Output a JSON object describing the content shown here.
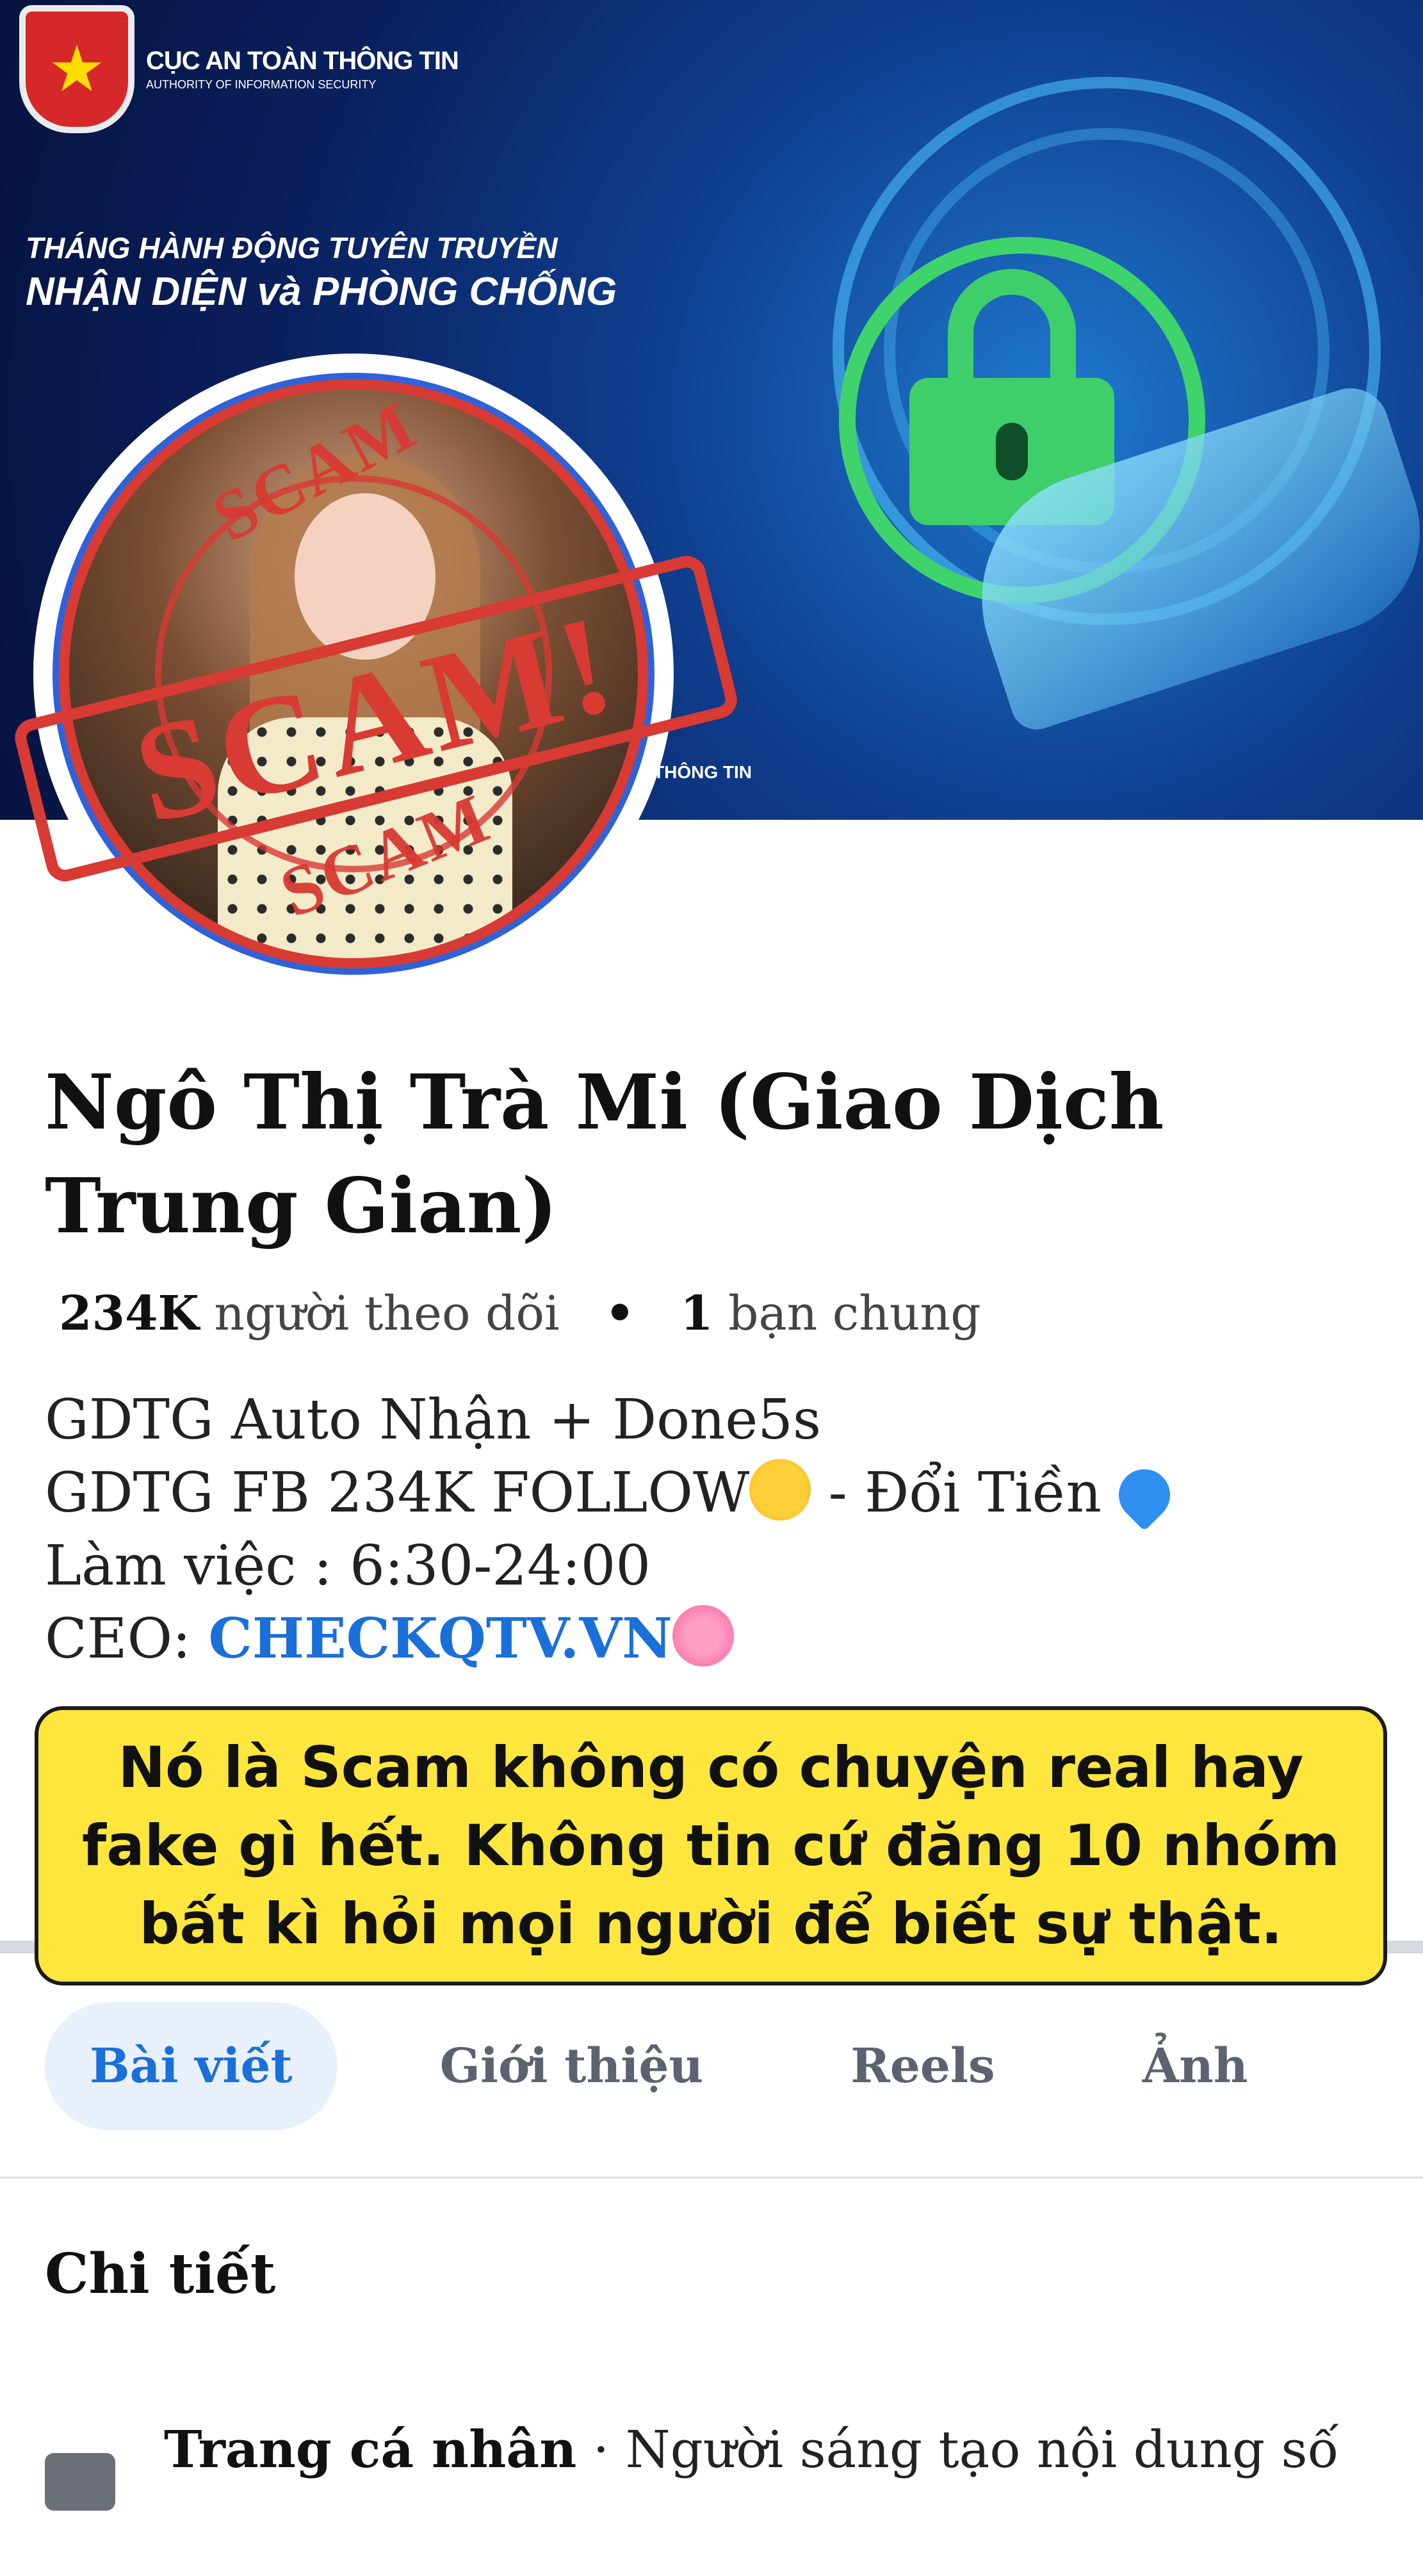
{
  "cover": {
    "org_name": "CỤC AN TOÀN THÔNG TIN",
    "org_subtitle": "AUTHORITY OF INFORMATION SECURITY",
    "headline_line1": "THÁNG HÀNH ĐỘNG TUYÊN TRUYỀN",
    "headline_line2": "NHẬN DIỆN và PHÒNG CHỐNG",
    "corner_text": "THÔNG TIN"
  },
  "avatar": {
    "stamp_main": "SCAM!",
    "stamp_top": "SCAM",
    "stamp_bottom": "SCAM"
  },
  "profile": {
    "name": "Ngô Thị Trà Mi (Giao Dịch Trung Gian)",
    "followers_count": "234K",
    "followers_label": "người theo dõi",
    "separator": "•",
    "mutual_count": "1",
    "mutual_label": "bạn chung"
  },
  "bio": {
    "line1": "GDTG Auto Nhận + Done5s",
    "line2_a": "GDTG FB 234K FOLLOW",
    "line2_b": " - Đổi Tiền ",
    "line3": "Làm việc : 6:30-24:00",
    "line4_prefix": "CEO: ",
    "line4_link": "CHECKQTV.VN"
  },
  "note": {
    "text": "Nó là Scam không có chuyện real hay fake gì hết. Không tin cứ đăng 10 nhóm bất kì hỏi mọi người để biết sự thật."
  },
  "tabs": [
    "Bài viết",
    "Giới thiệu",
    "Reels",
    "Ảnh"
  ],
  "details": {
    "title": "Chi tiết",
    "row_bold": "Trang cá nhân",
    "row_rest": " · Người sáng tạo nội dung số"
  },
  "colors": {
    "accent": "#1b6fd8",
    "stamp_red": "#d83a34",
    "note_yellow": "#ffe63c"
  }
}
